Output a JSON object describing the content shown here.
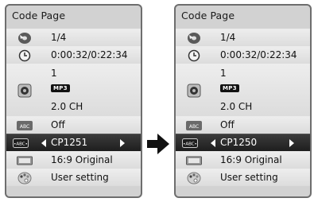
{
  "panels": [
    {
      "title": "Code Page",
      "rows": {
        "title_num": "1/4",
        "time": "0:00:32/0:22:34",
        "audio_track": "1",
        "audio_codec": "MP3",
        "audio_channels": "2.0 CH",
        "subtitle": "Off",
        "code_page": "CP1251",
        "aspect": "16:9 Original",
        "picture_mode": "User setting"
      }
    },
    {
      "title": "Code Page",
      "rows": {
        "title_num": "1/4",
        "time": "0:00:32/0:22:34",
        "audio_track": "1",
        "audio_codec": "MP3",
        "audio_channels": "2.0 CH",
        "subtitle": "Off",
        "code_page": "CP1250",
        "aspect": "16:9 Original",
        "picture_mode": "User setting"
      }
    }
  ],
  "icons": {
    "title_num": "disc-icon",
    "time": "clock-icon",
    "audio": "speaker-icon",
    "subtitle": "abc-subtitle-icon",
    "code_page": "abc-codepage-icon",
    "aspect": "screen-ratio-icon",
    "picture_mode": "palette-icon"
  },
  "colors": {
    "panel_bg": "#d2d2d2",
    "selected_row": "#1e1e1e",
    "selected_text": "#ffffff"
  }
}
